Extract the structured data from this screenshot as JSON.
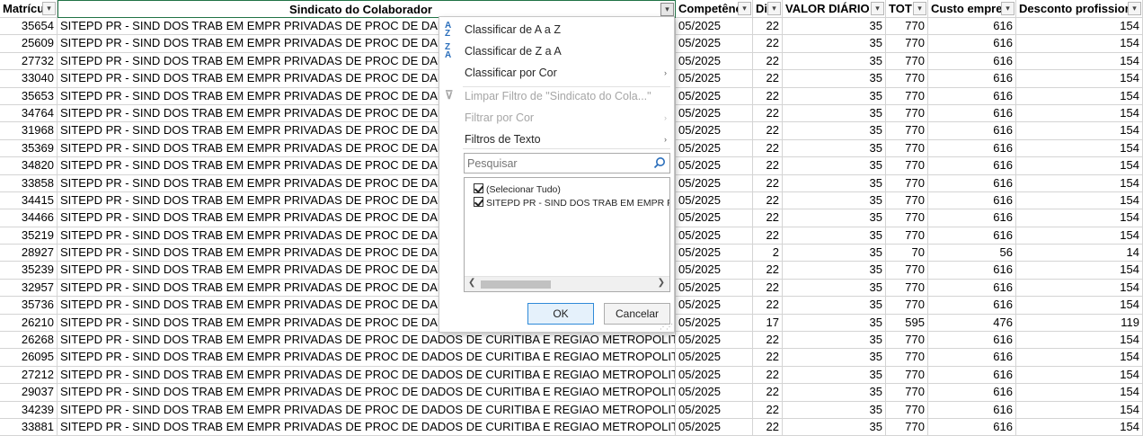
{
  "columns": [
    {
      "label": "Matrícu",
      "align": "left"
    },
    {
      "label": "Sindicato do Colaborador",
      "align": "center"
    },
    {
      "label": "Competênc",
      "align": "left"
    },
    {
      "label": "Di",
      "align": "left"
    },
    {
      "label": "VALOR DIÁRIO V",
      "align": "left"
    },
    {
      "label": "TOT",
      "align": "left"
    },
    {
      "label": "Custo empre",
      "align": "left"
    },
    {
      "label": "Desconto profissior",
      "align": "left"
    }
  ],
  "rows": [
    [
      "35654",
      "SITEPD PR - SIND DOS TRAB EM EMPR PRIVADAS DE PROC DE DADOS DE CURITIBA E REGIAO METROPOLITANA",
      "05/2025",
      "22",
      "35",
      "770",
      "616",
      "154"
    ],
    [
      "25609",
      "SITEPD PR - SIND DOS TRAB EM EMPR PRIVADAS DE PROC DE DADOS DE CURITIBA E REGIAO METROPOLITANA",
      "05/2025",
      "22",
      "35",
      "770",
      "616",
      "154"
    ],
    [
      "27732",
      "SITEPD PR - SIND DOS TRAB EM EMPR PRIVADAS DE PROC DE DADOS DE CURITIBA E REGIAO METROPOLITANA",
      "05/2025",
      "22",
      "35",
      "770",
      "616",
      "154"
    ],
    [
      "33040",
      "SITEPD PR - SIND DOS TRAB EM EMPR PRIVADAS DE PROC DE DADOS DE CURITIBA E REGIAO METROPOLITANA",
      "05/2025",
      "22",
      "35",
      "770",
      "616",
      "154"
    ],
    [
      "35653",
      "SITEPD PR - SIND DOS TRAB EM EMPR PRIVADAS DE PROC DE DADOS DE CURITIBA E REGIAO METROPOLITANA",
      "05/2025",
      "22",
      "35",
      "770",
      "616",
      "154"
    ],
    [
      "34764",
      "SITEPD PR - SIND DOS TRAB EM EMPR PRIVADAS DE PROC DE DADOS DE CURITIBA E REGIAO METROPOLITANA",
      "05/2025",
      "22",
      "35",
      "770",
      "616",
      "154"
    ],
    [
      "31968",
      "SITEPD PR - SIND DOS TRAB EM EMPR PRIVADAS DE PROC DE DADOS DE CURITIBA E REGIAO METROPOLITANA",
      "05/2025",
      "22",
      "35",
      "770",
      "616",
      "154"
    ],
    [
      "35369",
      "SITEPD PR - SIND DOS TRAB EM EMPR PRIVADAS DE PROC DE DADOS DE CURITIBA E REGIAO METROPOLITANA",
      "05/2025",
      "22",
      "35",
      "770",
      "616",
      "154"
    ],
    [
      "34820",
      "SITEPD PR - SIND DOS TRAB EM EMPR PRIVADAS DE PROC DE DADOS DE CURITIBA E REGIAO METROPOLITANA",
      "05/2025",
      "22",
      "35",
      "770",
      "616",
      "154"
    ],
    [
      "33858",
      "SITEPD PR - SIND DOS TRAB EM EMPR PRIVADAS DE PROC DE DADOS DE CURITIBA E REGIAO METROPOLITANA",
      "05/2025",
      "22",
      "35",
      "770",
      "616",
      "154"
    ],
    [
      "34415",
      "SITEPD PR - SIND DOS TRAB EM EMPR PRIVADAS DE PROC DE DADOS DE CURITIBA E REGIAO METROPOLITANA",
      "05/2025",
      "22",
      "35",
      "770",
      "616",
      "154"
    ],
    [
      "34466",
      "SITEPD PR - SIND DOS TRAB EM EMPR PRIVADAS DE PROC DE DADOS DE CURITIBA E REGIAO METROPOLITANA",
      "05/2025",
      "22",
      "35",
      "770",
      "616",
      "154"
    ],
    [
      "35219",
      "SITEPD PR - SIND DOS TRAB EM EMPR PRIVADAS DE PROC DE DADOS DE CURITIBA E REGIAO METROPOLITANA",
      "05/2025",
      "22",
      "35",
      "770",
      "616",
      "154"
    ],
    [
      "28927",
      "SITEPD PR - SIND DOS TRAB EM EMPR PRIVADAS DE PROC DE DADOS DE CURITIBA E REGIAO METROPOLITANA",
      "05/2025",
      "2",
      "35",
      "70",
      "56",
      "14"
    ],
    [
      "35239",
      "SITEPD PR - SIND DOS TRAB EM EMPR PRIVADAS DE PROC DE DADOS DE CURITIBA E REGIAO METROPOLITANA",
      "05/2025",
      "22",
      "35",
      "770",
      "616",
      "154"
    ],
    [
      "32957",
      "SITEPD PR - SIND DOS TRAB EM EMPR PRIVADAS DE PROC DE DADOS DE CURITIBA E REGIAO METROPOLITANA",
      "05/2025",
      "22",
      "35",
      "770",
      "616",
      "154"
    ],
    [
      "35736",
      "SITEPD PR - SIND DOS TRAB EM EMPR PRIVADAS DE PROC DE DADOS DE CURITIBA E REGIAO METROPOLITANA",
      "05/2025",
      "22",
      "35",
      "770",
      "616",
      "154"
    ],
    [
      "26210",
      "SITEPD PR - SIND DOS TRAB EM EMPR PRIVADAS DE PROC DE DADOS DE CURITIBA E REGIAO METROPOLITANA",
      "05/2025",
      "17",
      "35",
      "595",
      "476",
      "119"
    ],
    [
      "26268",
      "SITEPD PR - SIND DOS TRAB EM EMPR PRIVADAS DE PROC DE DADOS DE CURITIBA E REGIAO METROPOLITANA",
      "05/2025",
      "22",
      "35",
      "770",
      "616",
      "154"
    ],
    [
      "26095",
      "SITEPD PR - SIND DOS TRAB EM EMPR PRIVADAS DE PROC DE DADOS DE CURITIBA E REGIAO METROPOLITANA",
      "05/2025",
      "22",
      "35",
      "770",
      "616",
      "154"
    ],
    [
      "27212",
      "SITEPD PR - SIND DOS TRAB EM EMPR PRIVADAS DE PROC DE DADOS DE CURITIBA E REGIAO METROPOLITANA",
      "05/2025",
      "22",
      "35",
      "770",
      "616",
      "154"
    ],
    [
      "29037",
      "SITEPD PR - SIND DOS TRAB EM EMPR PRIVADAS DE PROC DE DADOS DE CURITIBA E REGIAO METROPOLITANA",
      "05/2025",
      "22",
      "35",
      "770",
      "616",
      "154"
    ],
    [
      "34239",
      "SITEPD PR - SIND DOS TRAB EM EMPR PRIVADAS DE PROC DE DADOS DE CURITIBA E REGIAO METROPOLITANA",
      "05/2025",
      "22",
      "35",
      "770",
      "616",
      "154"
    ],
    [
      "33881",
      "SITEPD PR - SIND DOS TRAB EM EMPR PRIVADAS DE PROC DE DADOS DE CURITIBA E REGIAO METROPOLITANA",
      "05/2025",
      "22",
      "35",
      "770",
      "616",
      "154"
    ]
  ],
  "filter_menu": {
    "sort_az": "Classificar de A a Z",
    "sort_za": "Classificar de Z a A",
    "sort_by_color": "Classificar por Cor",
    "clear_filter": "Limpar Filtro de \"Sindicato do Cola...\"",
    "filter_by_color": "Filtrar por Cor",
    "text_filters": "Filtros de Texto",
    "search_placeholder": "Pesquisar",
    "list_items": [
      {
        "label": "(Selecionar Tudo)",
        "checked": true
      },
      {
        "label": "SITEPD PR - SIND DOS TRAB EM EMPR PRIVADAS DE PROC DE DADOS DE CURITIBA E REGIAO METROPOLITANA",
        "checked": true
      }
    ],
    "ok_label": "OK",
    "cancel_label": "Cancelar",
    "icons": [
      "sort-az-icon",
      "sort-za-icon",
      "clear-filter-icon",
      "search-icon",
      "submenu-arrow-icon",
      "filter-dropdown-icon"
    ]
  },
  "colors": {
    "gridline": "#d4d4d4",
    "selected_cell_border": "#217346",
    "ok_button_border": "#2f8ad8",
    "sort_icon_blue": "#2a6ebb"
  }
}
